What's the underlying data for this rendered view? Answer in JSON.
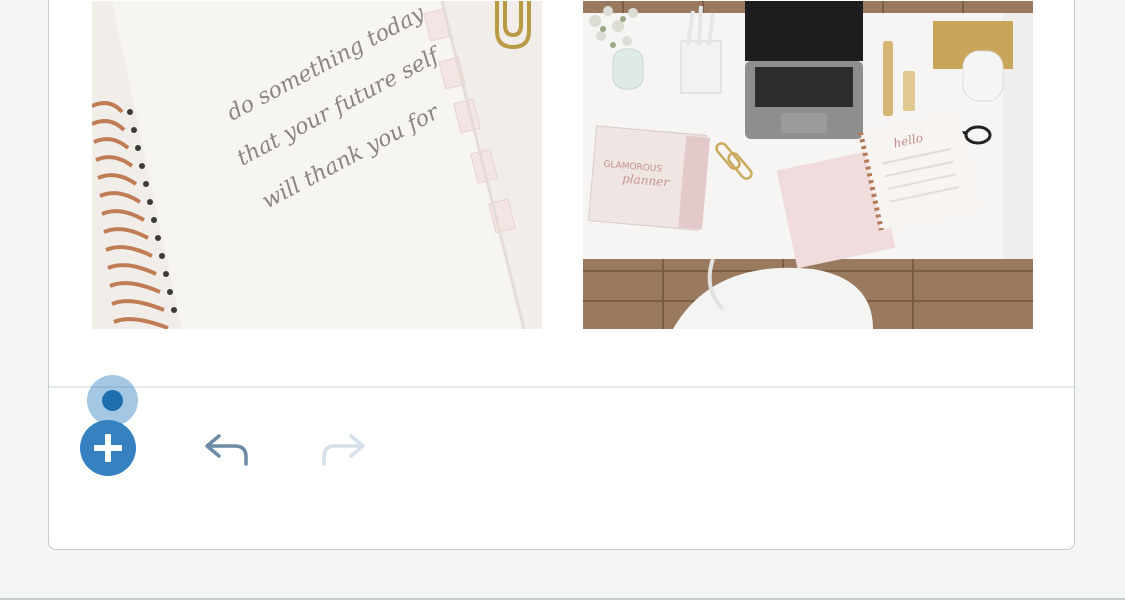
{
  "gallery": {
    "images": [
      {
        "name": "planner-notebook-photo",
        "handwriting": [
          "do something today",
          "that your future self",
          "will thank you for"
        ]
      },
      {
        "name": "desk-flatlay-photo",
        "book_cover_text": [
          "GLAMOROUS",
          "planner"
        ],
        "notebook_text": "hello"
      }
    ]
  },
  "toolbar": {
    "add_icon": "plus-circle-icon",
    "undo_icon": "undo-arrow-icon",
    "redo_icon": "redo-arrow-icon",
    "redo_enabled": false
  },
  "colors": {
    "accent": "#3682c0",
    "undo_active": "#6c8ba6",
    "redo_disabled": "#d5e0ea"
  }
}
